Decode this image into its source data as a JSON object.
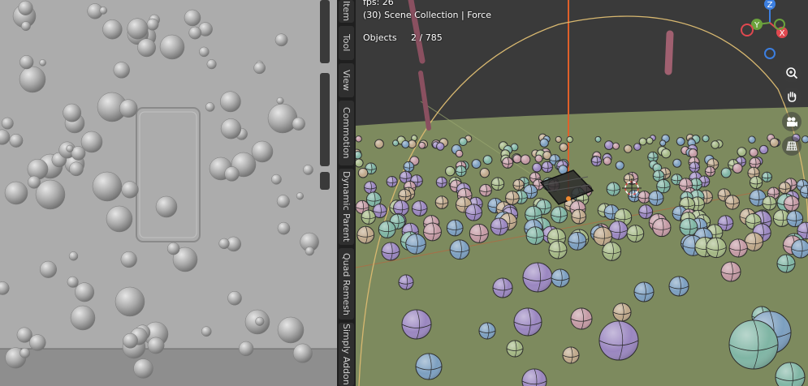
{
  "viewport": {
    "fps_label": "fps: 26",
    "collection_label": "(30) Scene Collection | Force",
    "objects_label": "Objects",
    "objects_value": "2 / 785"
  },
  "n_panel_tabs": [
    "Item",
    "Tool",
    "View",
    "Commotion",
    "Dynamic Parent",
    "Quad Remesh",
    "Simply Addon"
  ],
  "gizmo_axes": [
    "Z",
    "Y",
    "X"
  ],
  "nav_buttons": [
    "zoom-icon",
    "hand-pan-icon",
    "camera-icon",
    "grid-ortho-icon"
  ],
  "colors": {
    "ground": "#7d8a5e",
    "sky": "#3a3a3a",
    "sphere_purple": "#9a86c0",
    "sphere_blue": "#7c9fc0",
    "sphere_teal": "#7fb5a4",
    "sphere_pink": "#c49aa4",
    "sphere_tan": "#bfa88a",
    "sphere_green": "#a4b884",
    "axis_x": "#e0484f",
    "axis_y": "#6ba23c",
    "axis_z": "#3c7fe0"
  }
}
